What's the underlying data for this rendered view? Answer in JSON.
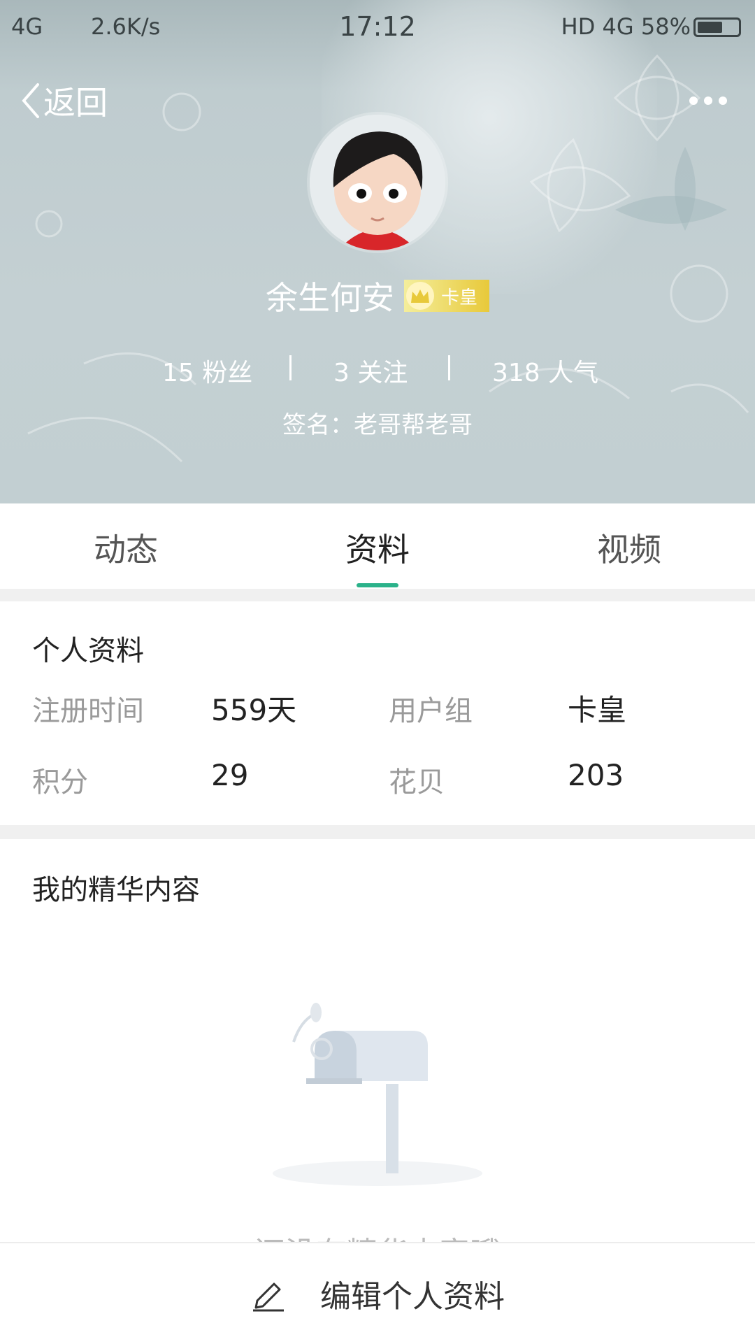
{
  "status_bar": {
    "signal": "4G",
    "speed": "2.6K/s",
    "time": "17:12",
    "right": "HD 4G 58%",
    "icons": [
      "vibrate-icon",
      "alarm-icon",
      "battery-icon"
    ]
  },
  "nav": {
    "back_label": "返回"
  },
  "profile": {
    "name": "余生何安",
    "badge": "卡皇",
    "stats": [
      {
        "text": "15 粉丝"
      },
      {
        "text": "3 关注"
      },
      {
        "text": "318 人气"
      }
    ],
    "signature": "签名：老哥帮老哥"
  },
  "tabs": [
    {
      "label": "动态"
    },
    {
      "label": "资料"
    },
    {
      "label": "视频"
    }
  ],
  "active_tab": "资料",
  "info": {
    "title": "个人资料",
    "rows": [
      {
        "label1": "注册时间",
        "value1": "559天",
        "label2": "用户组",
        "value2": "卡皇"
      },
      {
        "label1": "积分",
        "value1": "29",
        "label2": "花贝",
        "value2": "203"
      }
    ]
  },
  "featured": {
    "title": "我的精华内容",
    "empty_text": "还没有精华内容哦"
  },
  "bottom": {
    "edit_label": "编辑个人资料"
  },
  "colors": {
    "accent": "#2bb28a",
    "badge": "#e8c93a"
  }
}
